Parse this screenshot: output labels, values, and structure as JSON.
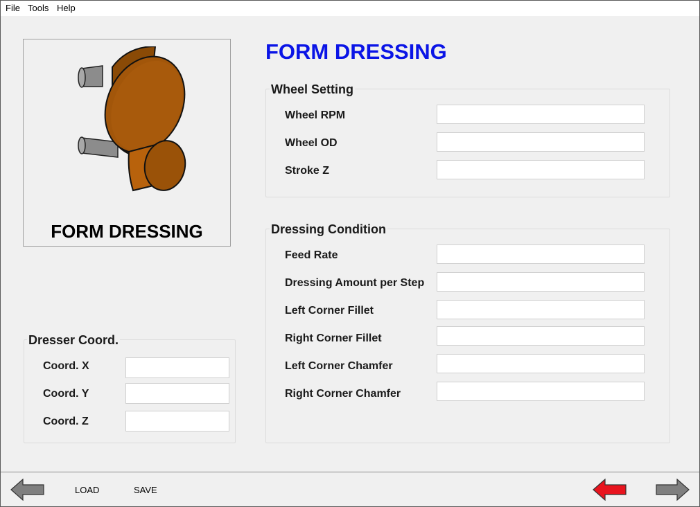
{
  "menu": [
    "File",
    "Tools",
    "Help"
  ],
  "title": "FORM DRESSING",
  "image_caption": "FORM DRESSING",
  "wheel_setting": {
    "title": "Wheel Setting",
    "fields": [
      {
        "label": "Wheel RPM",
        "value": ""
      },
      {
        "label": "Wheel OD",
        "value": ""
      },
      {
        "label": "Stroke Z",
        "value": ""
      }
    ]
  },
  "dressing_condition": {
    "title": "Dressing Condition",
    "fields": [
      {
        "label": "Feed Rate",
        "value": ""
      },
      {
        "label": "Dressing Amount per Step",
        "value": ""
      },
      {
        "label": "Left Corner Fillet",
        "value": ""
      },
      {
        "label": "Right Corner Fillet",
        "value": ""
      },
      {
        "label": "Left Corner Chamfer",
        "value": ""
      },
      {
        "label": "Right Corner Chamfer",
        "value": ""
      }
    ]
  },
  "dresser_coord": {
    "title": "Dresser Coord.",
    "fields": [
      {
        "label": "Coord. X",
        "value": ""
      },
      {
        "label": "Coord. Y",
        "value": ""
      },
      {
        "label": "Coord. Z",
        "value": ""
      }
    ]
  },
  "footer": {
    "load_label": "LOAD",
    "save_label": "SAVE"
  },
  "colors": {
    "title": "#0a14e6",
    "active_arrow": "#e8141e",
    "inactive_arrow": "#7f7f7f",
    "wheel_body": "#b8620c"
  },
  "icons": {
    "back": "left-arrow-icon",
    "return": "red-left-arrow-icon",
    "next": "right-arrow-icon"
  }
}
